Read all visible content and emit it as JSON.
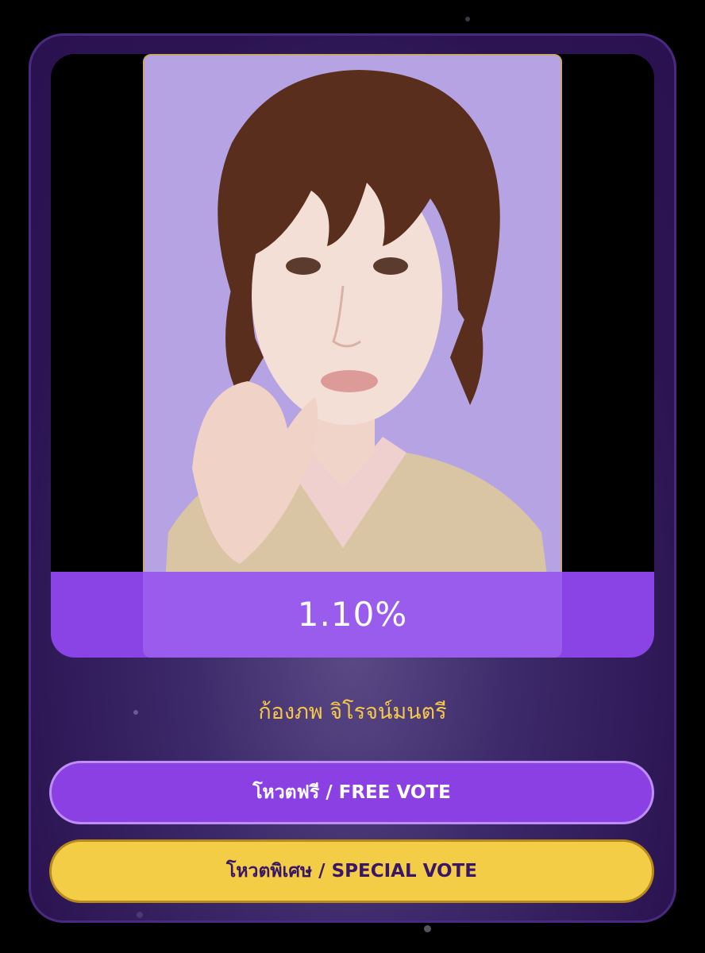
{
  "colors": {
    "card_bg": "#2c1452",
    "accent_purple": "#8a40e2",
    "accent_gold": "#f3cd45",
    "name_color": "#f5c84a"
  },
  "candidate": {
    "photo_icon": "candidate-portrait",
    "percent": "1.10%",
    "name": "ก้องภพ จิโรจน์มนตรี"
  },
  "buttons": {
    "free_vote": "โหวตฟรี / FREE VOTE",
    "special_vote": "โหวตพิเศษ / SPECIAL VOTE"
  }
}
